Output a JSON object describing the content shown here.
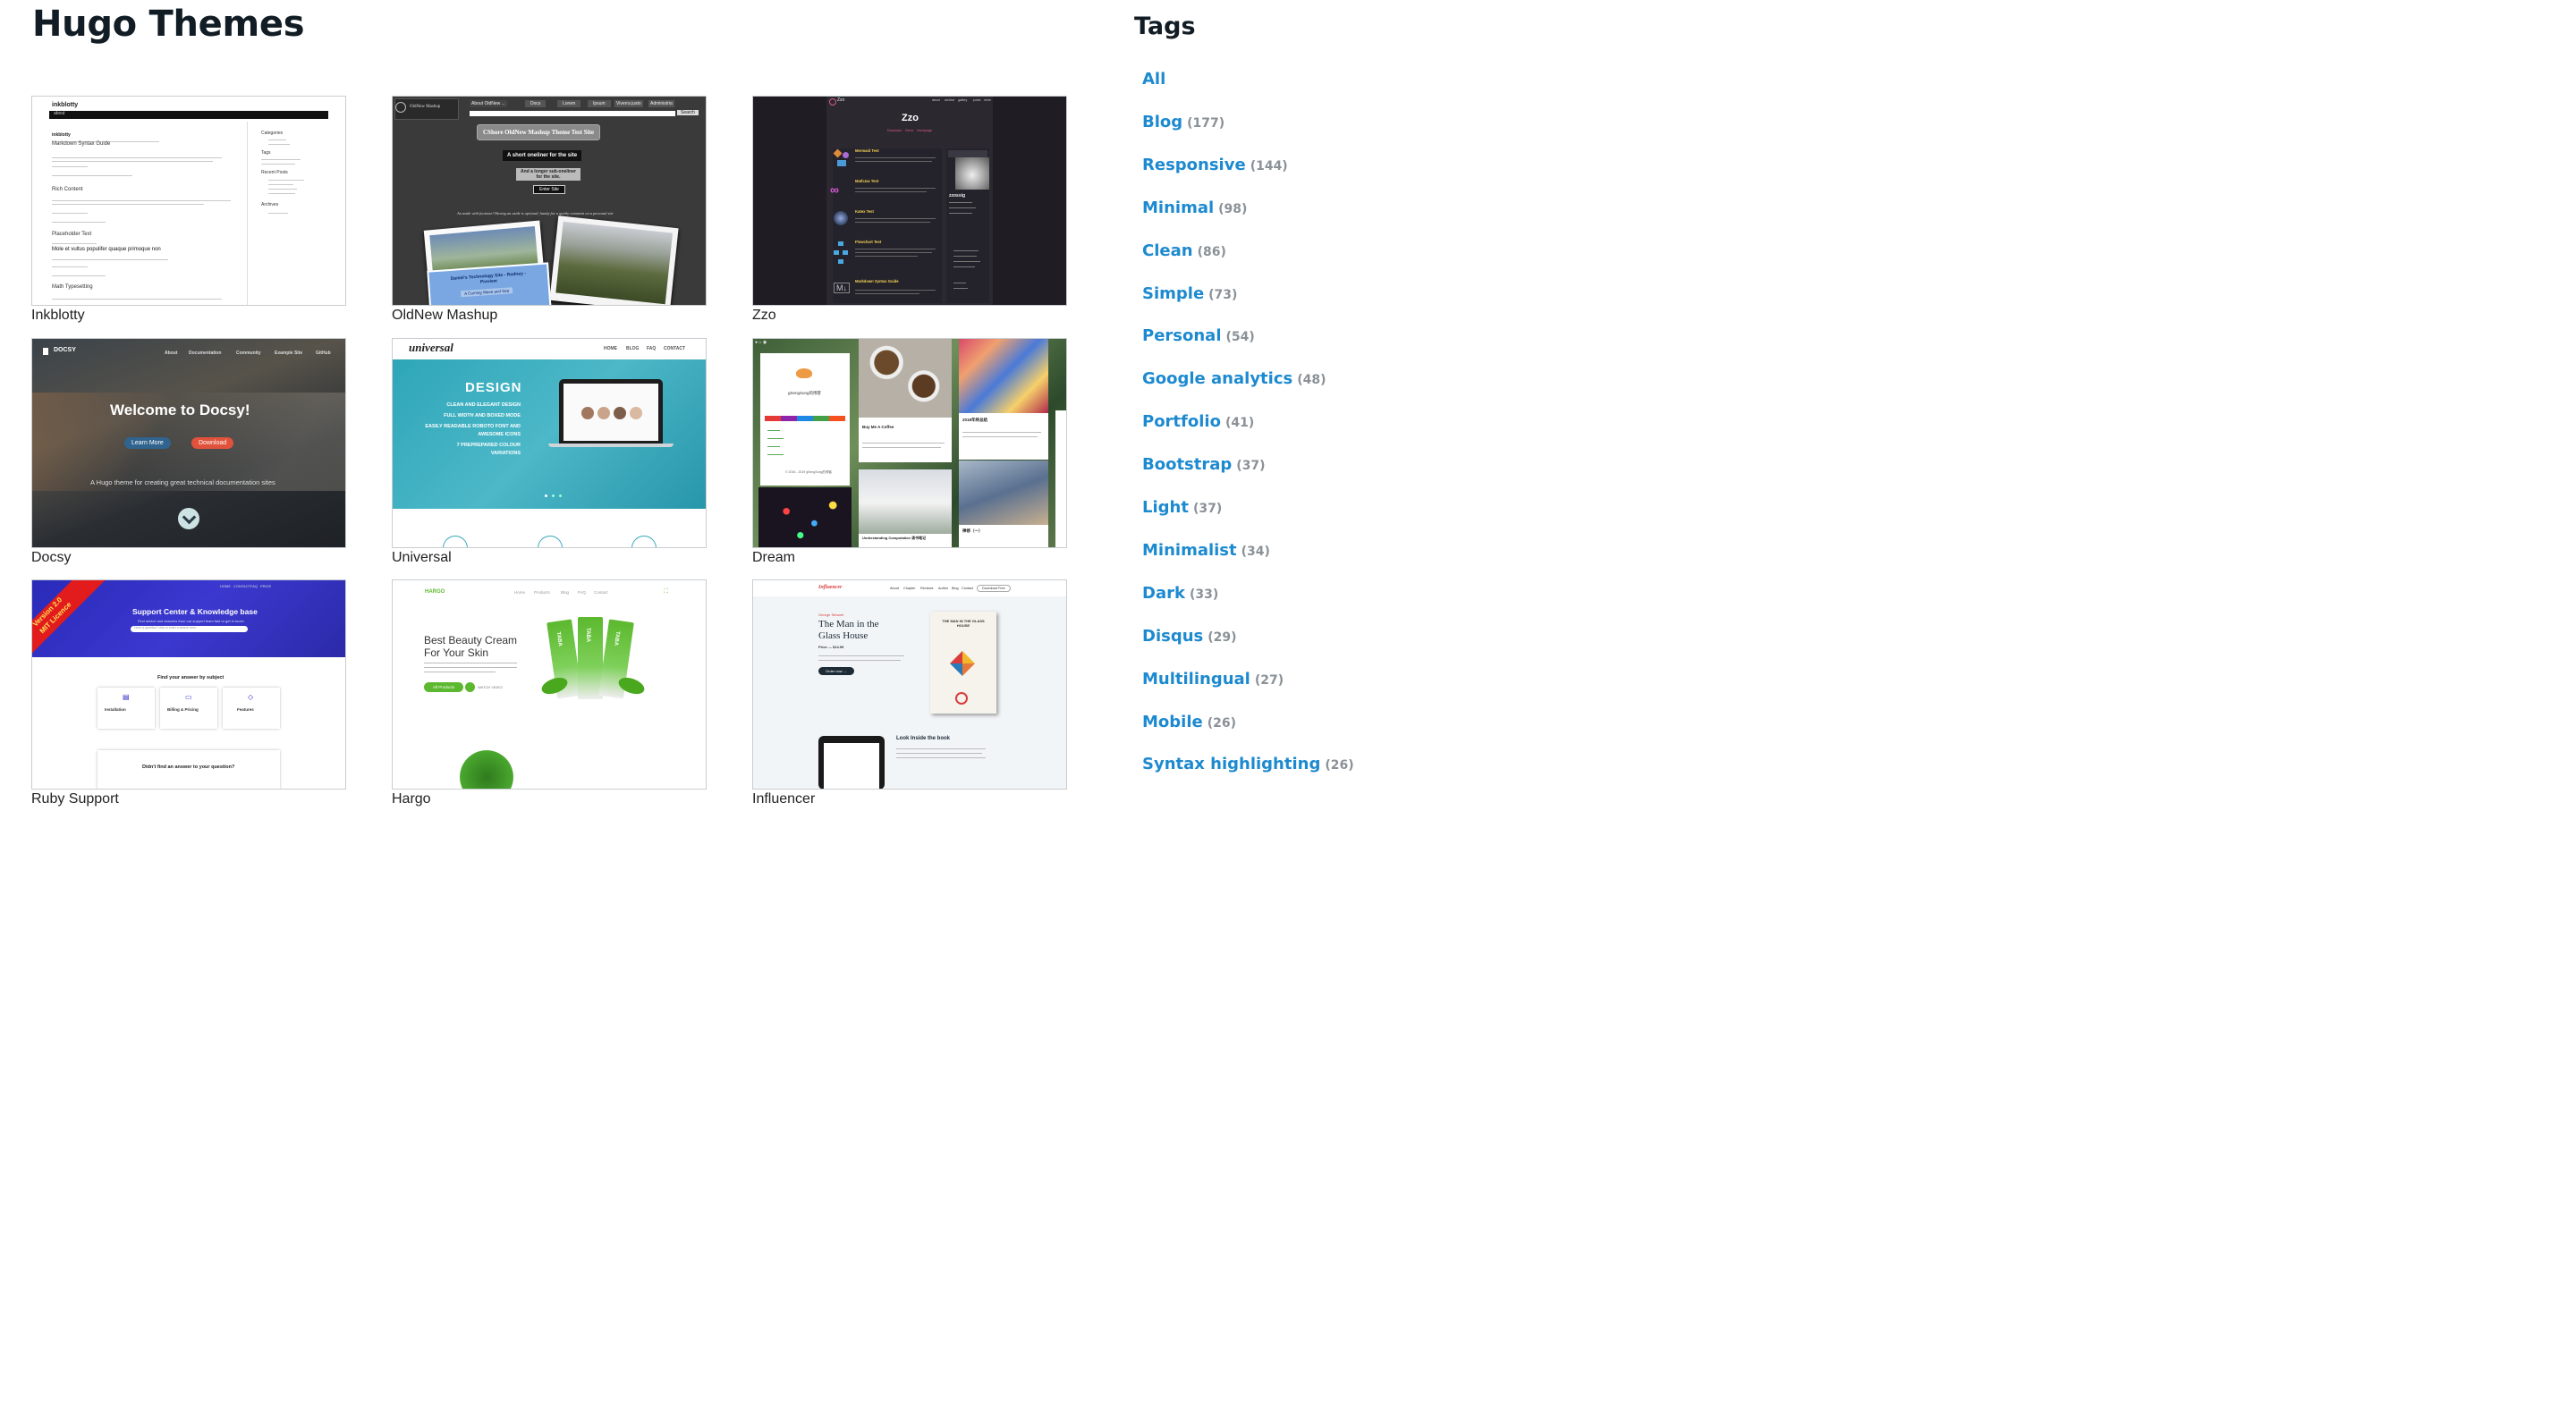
{
  "page": {
    "title": "Hugo Themes"
  },
  "themes": [
    {
      "name": "Inkblotty"
    },
    {
      "name": "OldNew Mashup"
    },
    {
      "name": "Zzo"
    },
    {
      "name": "Docsy"
    },
    {
      "name": "Universal"
    },
    {
      "name": "Dream"
    },
    {
      "name": "Ruby Support"
    },
    {
      "name": "Hargo"
    },
    {
      "name": "Influencer"
    }
  ],
  "previews": {
    "inkblotty": {
      "site": "inkblotty",
      "nav": "about",
      "post1": "inkblotty",
      "post2": "Markdown Syntax Guide",
      "post3": "Rich Content",
      "post4": "Placeholder Text",
      "post5": "Mole et vultus populifer quaque primoque non",
      "post6": "Math Typesetting",
      "side1": "Categories",
      "side2": "Tags",
      "side3": "Recent Posts",
      "side4": "Archives"
    },
    "oldnew": {
      "logo": "OldNew Mashup",
      "menu": [
        "About OldNew ...",
        "Docs",
        "Lorem",
        "Ipsum",
        "Viverra justo",
        "Administria"
      ],
      "search": "Search",
      "site_title": "CShore OldNew Mashup Theme Test Site",
      "oneliner": "A short oneliner for the site",
      "subline": "And a longer sub-oneliner for the site.",
      "enter": "Enter Site",
      "aside": "An aside with footnote! Having an aside is optional, handy for a quirky comment on a personal site",
      "photo_title": "Daniel's Technology Site - Rodney - Preview",
      "photo_sub": "A Coming Wave and Sea"
    },
    "zzo": {
      "brand": "Zzo",
      "nav": [
        "about",
        "archive",
        "gallery",
        "posts",
        "more"
      ],
      "hero": "Zzo",
      "hero_links": [
        "Download",
        "Demo",
        "Homepage"
      ],
      "posts": [
        "Mermaid Test",
        "MathJax Test",
        "Katex Test",
        "Flowchart Test",
        "Markdown Syntax Guide"
      ],
      "profile": "zzossig"
    },
    "docsy": {
      "brand": "DOCSY",
      "nav": [
        "About",
        "Documentation",
        "Community",
        "Example Site",
        "GitHub"
      ],
      "headline": "Welcome to Docsy!",
      "btn_learn": "Learn More",
      "btn_download": "Download",
      "tagline": "A Hugo theme for creating great technical documentation sites"
    },
    "universal": {
      "logo": "universal",
      "nav": [
        "HOME",
        "BLOG",
        "FAQ",
        "CONTACT"
      ],
      "heading": "DESIGN",
      "bullets": [
        "CLEAN AND ELEGANT DESIGN",
        "FULL WIDTH AND BOXED MODE",
        "EASILY READABLE ROBOTO FONT AND",
        "AWESOME ICONS",
        "7 PREPREPARED COLOUR",
        "VARIATIONS"
      ]
    },
    "dream": {
      "profile": "gSengSung的博客",
      "copyright": "© 2016 - 2019 gSengSung的博客",
      "card1_title": "Buy Me A Coffee",
      "card2_title": "2018年终总结",
      "card3_title": "Understanding Computation 读书笔记",
      "card4_title": "禅修（一）"
    },
    "ruby": {
      "ribbon_line1": "Version 2.0",
      "ribbon_line2": "MIT Licence",
      "nav": [
        "HOME",
        "CONTACT",
        "FAQ",
        "PRICE"
      ],
      "hero_title": "Support Center & Knowledge base",
      "hero_sub": "Find advice and answers from our support team fast or get in touch",
      "search_placeholder": "Have a question? Ask or enter a search term",
      "subject_heading": "Find your answer by subject",
      "subjects": [
        "Installation",
        "Billing & Pricing",
        "Features"
      ],
      "bottom_text": "Didn't find an answer to your question?"
    },
    "hargo": {
      "logo": "HARGO",
      "nav": [
        "Home",
        "Products",
        "Blog",
        "FAQ",
        "Contact"
      ],
      "headline1": "Best Beauty Cream",
      "headline2": "For Your Skin",
      "btn_products": "All Products",
      "btn_video": "WATCH VIDEO",
      "tube_label": "TABA"
    },
    "influencer": {
      "logo": "Influencer",
      "nav": [
        "About",
        "Chapter",
        "Reviews",
        "Author",
        "Blog",
        "Contact"
      ],
      "nav_button": "Download Free",
      "kicker": "George Stewart",
      "title1": "The Man in the",
      "title2": "Glass House",
      "price": "Price — $14.99",
      "order_btn": "Order now →",
      "book_title": "THE MAN IN THE GLASS HOUSE",
      "look_inside": "Look Inside the book"
    }
  },
  "sidebar": {
    "heading": "Tags",
    "tags": [
      {
        "name": "All",
        "count": ""
      },
      {
        "name": "Blog",
        "count": "(177)"
      },
      {
        "name": "Responsive",
        "count": "(144)"
      },
      {
        "name": "Minimal",
        "count": "(98)"
      },
      {
        "name": "Clean",
        "count": "(86)"
      },
      {
        "name": "Simple",
        "count": "(73)"
      },
      {
        "name": "Personal",
        "count": "(54)"
      },
      {
        "name": "Google analytics",
        "count": "(48)"
      },
      {
        "name": "Portfolio",
        "count": "(41)"
      },
      {
        "name": "Bootstrap",
        "count": "(37)"
      },
      {
        "name": "Light",
        "count": "(37)"
      },
      {
        "name": "Minimalist",
        "count": "(34)"
      },
      {
        "name": "Dark",
        "count": "(33)"
      },
      {
        "name": "Disqus",
        "count": "(29)"
      },
      {
        "name": "Multilingual",
        "count": "(27)"
      },
      {
        "name": "Mobile",
        "count": "(26)"
      },
      {
        "name": "Syntax highlighting",
        "count": "(26)"
      }
    ]
  }
}
